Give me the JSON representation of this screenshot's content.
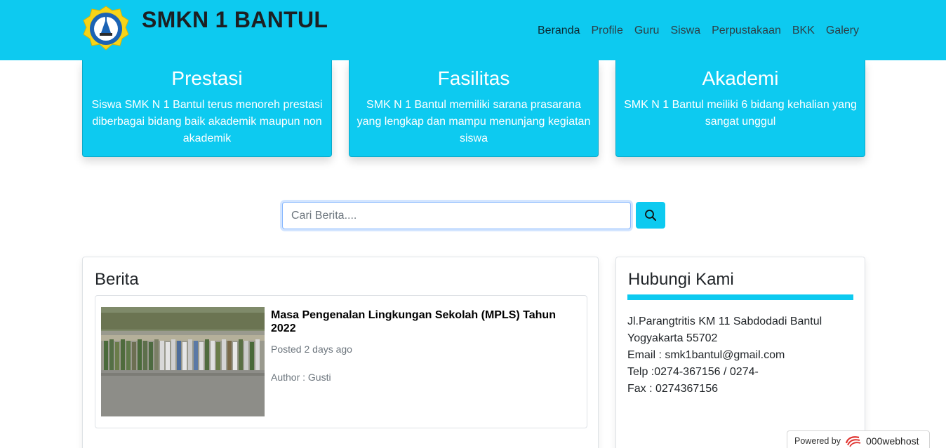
{
  "header": {
    "brand": "SMKN 1 BANTUL",
    "logo_icon": "school-emblem-icon",
    "nav": [
      {
        "label": "Beranda",
        "active": true
      },
      {
        "label": "Profile"
      },
      {
        "label": "Guru"
      },
      {
        "label": "Siswa"
      },
      {
        "label": "Perpustakaan"
      },
      {
        "label": "BKK"
      },
      {
        "label": "Galery"
      }
    ],
    "accent": "#0dcaf0"
  },
  "features": [
    {
      "title": "Prestasi",
      "text": "Siswa SMK N 1 Bantul terus menoreh prestasi diberbagai bidang baik akademik maupun non akademik"
    },
    {
      "title": "Fasilitas",
      "text": "SMK N 1 Bantul memiliki sarana prasarana yang lengkap dan mampu menunjang kegiatan siswa"
    },
    {
      "title": "Akademi",
      "text": "SMK N 1 Bantul meiliki 6 bidang kehalian yang sangat unggul"
    }
  ],
  "search": {
    "placeholder": "Cari Berita....",
    "button_icon": "search-icon"
  },
  "news": {
    "heading": "Berita",
    "items": [
      {
        "title": "Masa Pengenalan Lingkungan Sekolah (MPLS) Tahun 2022",
        "posted": "Posted 2 days ago",
        "author": "Author : Gusti"
      }
    ]
  },
  "contact": {
    "heading": "Hubungi Kami",
    "lines": [
      "Jl.Parangtritis KM 11 Sabdodadi Bantul",
      "Yogyakarta 55702",
      "Email : smk1bantul@gmail.com",
      "Telp :0274-367156 / 0274-",
      "Fax : 0274367156"
    ]
  },
  "footer_badge": {
    "prefix": "Powered by",
    "brand": "000webhost"
  }
}
